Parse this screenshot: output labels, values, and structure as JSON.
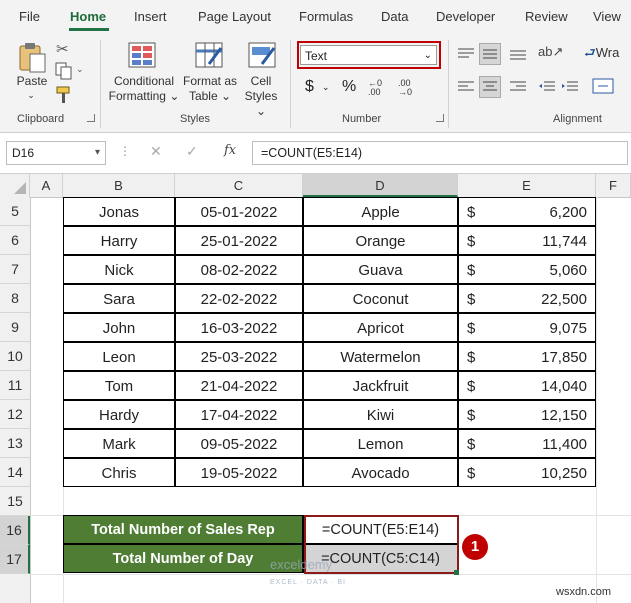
{
  "tabs": [
    "File",
    "Home",
    "Insert",
    "Page Layout",
    "Formulas",
    "Data",
    "Developer",
    "Review",
    "View"
  ],
  "ribbon": {
    "clipboard": {
      "paste": "Paste",
      "group": "Clipboard"
    },
    "styles": {
      "conditional": "Conditional",
      "formatting": "Formatting",
      "format_as": "Format as",
      "table": "Table",
      "cell": "Cell",
      "cell_styles": "Styles",
      "group": "Styles"
    },
    "number": {
      "format_value": "Text",
      "currency": "$",
      "percent": "%",
      "group": "Number"
    },
    "alignment": {
      "wrap": "Wra",
      "group": "Alignment"
    }
  },
  "formula_bar": {
    "name_box": "D16",
    "fx": "fx",
    "formula": "=COUNT(E5:E14)"
  },
  "columns": [
    "A",
    "B",
    "C",
    "D",
    "E",
    "F"
  ],
  "rows": [
    "5",
    "6",
    "7",
    "8",
    "9",
    "10",
    "11",
    "12",
    "13",
    "14",
    "15",
    "16",
    "17"
  ],
  "table": [
    {
      "name": "Jonas",
      "date": "05-01-2022",
      "item": "Apple",
      "cur": "$",
      "amount": "6,200"
    },
    {
      "name": "Harry",
      "date": "25-01-2022",
      "item": "Orange",
      "cur": "$",
      "amount": "11,744"
    },
    {
      "name": "Nick",
      "date": "08-02-2022",
      "item": "Guava",
      "cur": "$",
      "amount": "5,060"
    },
    {
      "name": "Sara",
      "date": "22-02-2022",
      "item": "Coconut",
      "cur": "$",
      "amount": "22,500"
    },
    {
      "name": "John",
      "date": "16-03-2022",
      "item": "Apricot",
      "cur": "$",
      "amount": "9,075"
    },
    {
      "name": "Leon",
      "date": "25-03-2022",
      "item": "Watermelon",
      "cur": "$",
      "amount": "17,850"
    },
    {
      "name": "Tom",
      "date": "21-04-2022",
      "item": "Jackfruit",
      "cur": "$",
      "amount": "14,040"
    },
    {
      "name": "Hardy",
      "date": "17-04-2022",
      "item": "Kiwi",
      "cur": "$",
      "amount": "12,150"
    },
    {
      "name": "Mark",
      "date": "09-05-2022",
      "item": "Lemon",
      "cur": "$",
      "amount": "11,400"
    },
    {
      "name": "Chris",
      "date": "19-05-2022",
      "item": "Avocado",
      "cur": "$",
      "amount": "10,250"
    }
  ],
  "summary": [
    {
      "label": "Total Number of Sales Rep",
      "formula": "=COUNT(E5:E14)"
    },
    {
      "label": "Total Number of Day",
      "formula": "=COUNT(C5:C14)"
    }
  ],
  "badge": "1",
  "watermark": "exceldemy",
  "watermark_sub": "EXCEL · DATA · BI",
  "site": "wsxdn.com",
  "colors": {
    "accent": "#217346",
    "header_green": "#4e7d33",
    "highlight": "#c00000"
  }
}
